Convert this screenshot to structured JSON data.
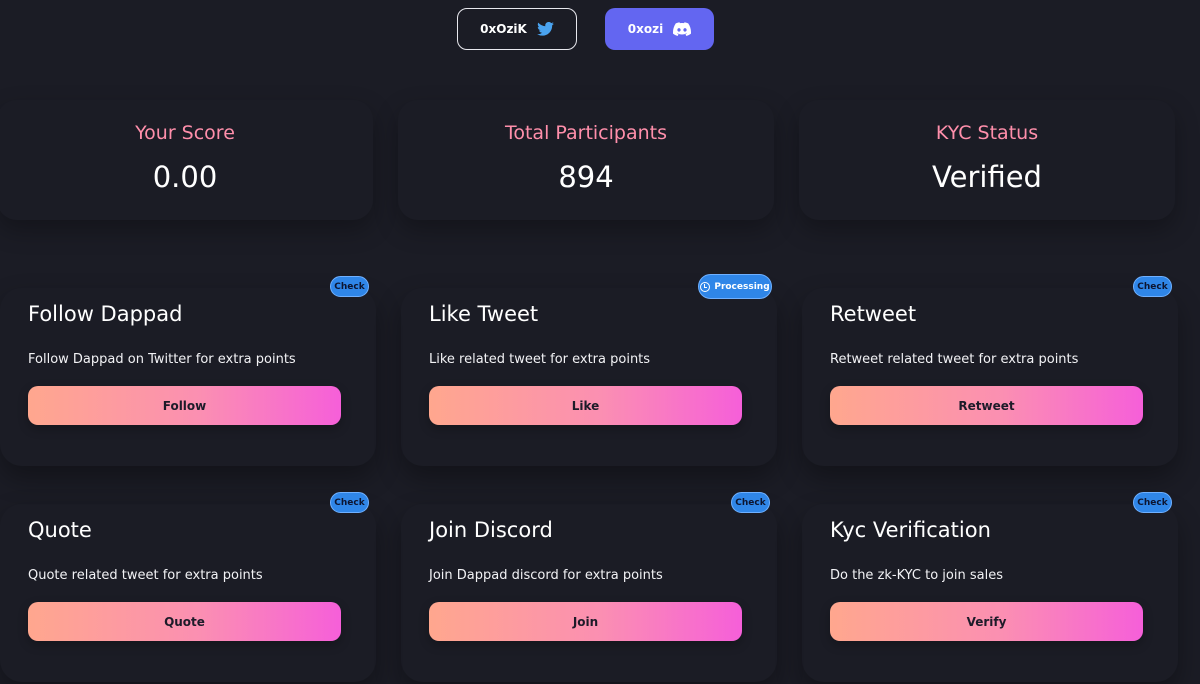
{
  "social": {
    "twitter_handle": "0xOziK",
    "discord_handle": "0xozi"
  },
  "stats": [
    {
      "label": "Your Score",
      "value": "0.00"
    },
    {
      "label": "Total Participants",
      "value": "894"
    },
    {
      "label": "KYC Status",
      "value": "Verified"
    }
  ],
  "tasks": [
    {
      "title": "Follow Dappad",
      "description": "Follow Dappad on Twitter for extra points",
      "button": "Follow",
      "badge": "Check"
    },
    {
      "title": "Like Tweet",
      "description": "Like related tweet for extra points",
      "button": "Like",
      "badge": "Processing"
    },
    {
      "title": "Retweet",
      "description": "Retweet related tweet for extra points",
      "button": "Retweet",
      "badge": "Check"
    },
    {
      "title": "Quote",
      "description": "Quote related tweet for extra points",
      "button": "Quote",
      "badge": "Check"
    },
    {
      "title": "Join Discord",
      "description": "Join Dappad discord for extra points",
      "button": "Join",
      "badge": "Check"
    },
    {
      "title": "Kyc Verification",
      "description": "Do the zk-KYC to join sales",
      "button": "Verify",
      "badge": "Check"
    }
  ],
  "colors": {
    "background": "#1b1c25",
    "stat_label": "#ff8fab",
    "discord_button": "#6366f1",
    "badge": "#2f86e8",
    "button_gradient_start": "#ffa78e",
    "button_gradient_end": "#f65fd9"
  },
  "icons": {
    "twitter": "twitter-bird-icon",
    "discord": "discord-icon",
    "processing": "clock-icon"
  }
}
